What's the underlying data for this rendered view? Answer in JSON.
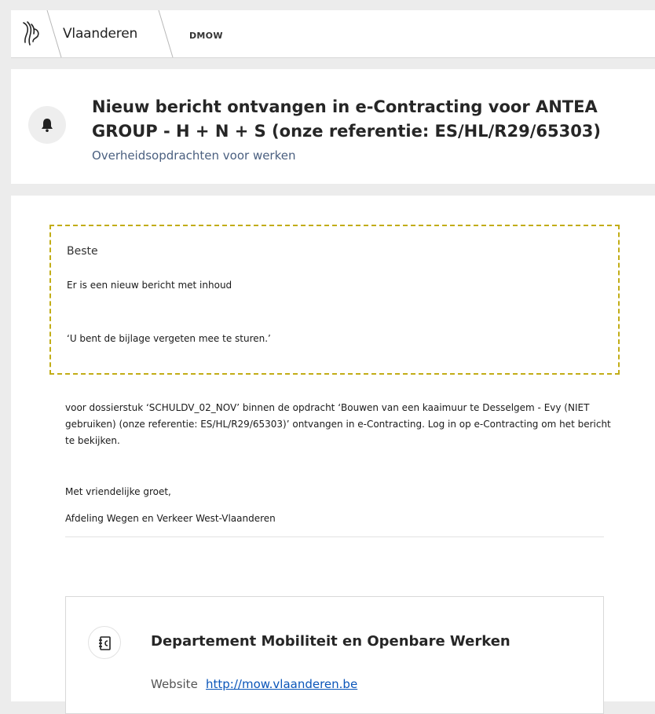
{
  "header": {
    "brand": "Vlaanderen",
    "department": "DMOW",
    "logo_icon": "flemish-lion-logo-icon",
    "colors": {
      "separator": "#b8b8b8"
    }
  },
  "notification": {
    "icon": "bell-icon",
    "title": "Nieuw bericht ontvangen in e-Contracting voor ANTEA GROUP - H + N + S (onze referentie: ES/HL/R29/65303)",
    "subtitle": "Overheidsopdrachten voor werken",
    "colors": {
      "subtitle": "#4b6080"
    }
  },
  "message": {
    "greeting": "Beste",
    "intro": "Er is een nieuw bericht met inhoud",
    "quote": "‘U bent de bijlage vergeten mee te sturen.’",
    "highlight_color": "#c2ad17",
    "body": "voor dossierstuk ‘SCHULDV_02_NOV’ binnen de opdracht ‘Bouwen van een kaaimuur te Desselgem - Evy (NIET gebruiken) (onze referentie: ES/HL/R29/65303)’ ontvangen in e-Contracting. Log in op e-Contracting om het bericht te bekijken.",
    "closing": "Met vriendelijke groet,",
    "signature": "Afdeling Wegen en Verkeer West-Vlaanderen"
  },
  "footer": {
    "icon": "address-book-icon",
    "organisation": "Departement Mobiliteit en Openbare Werken",
    "website_label": "Website",
    "website_url": "http://mow.vlaanderen.be",
    "link_color": "#0a55b9"
  }
}
